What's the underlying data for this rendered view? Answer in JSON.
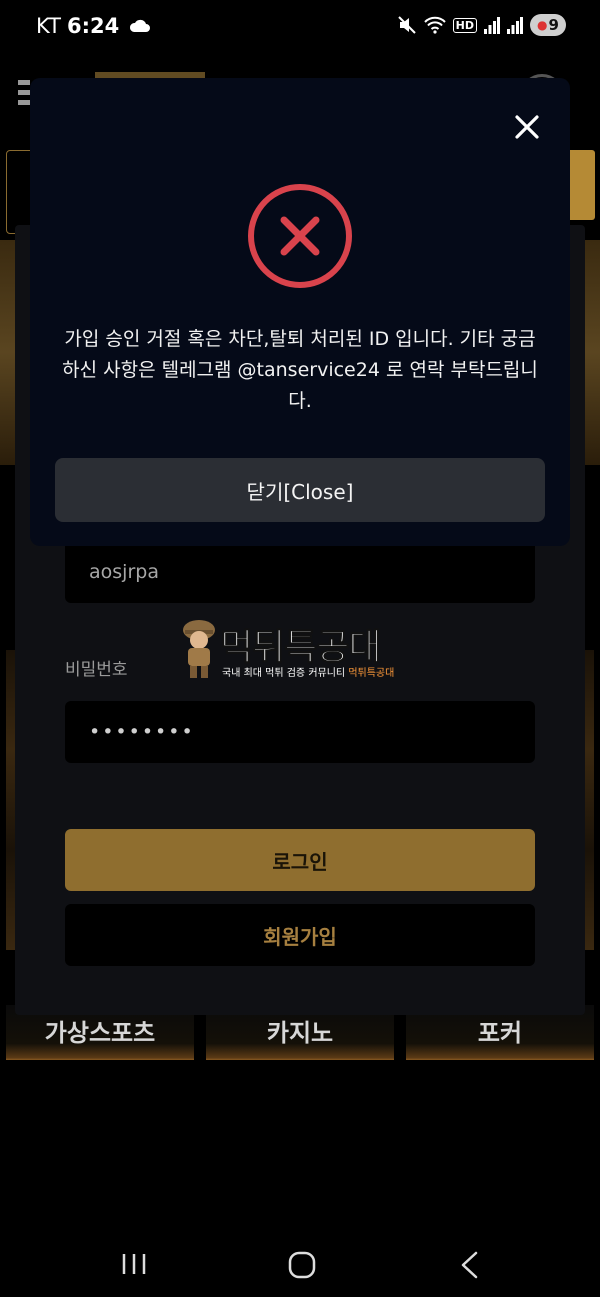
{
  "status_bar": {
    "carrier": "KT",
    "time": "6:24",
    "hd_badge": "HD",
    "battery_level": "9",
    "icons": [
      "cloud-icon",
      "mute-icon",
      "wifi-icon",
      "signal-icon",
      "signal-r-icon",
      "battery-icon"
    ]
  },
  "modal": {
    "message": "가입 승인 거절 혹은 차단,탈퇴 처리된 ID 입니다. 기타 궁금하신 사항은 텔레그램 @tanservice24 로 연락 부탁드립니다.",
    "close_button_label": "닫기[Close]",
    "error_color": "#d9434c"
  },
  "login_form": {
    "username_value": "aosjrpa",
    "password_label": "비밀번호",
    "password_value": "••••••••",
    "login_button": "로그인",
    "signup_button": "회원가입",
    "accent_color": "#8f6e2f"
  },
  "categories": [
    "가상스포츠",
    "카지노",
    "포커"
  ],
  "watermark": {
    "title": "먹튀특공대",
    "subtitle_prefix": "국내 최대 먹튀 검증 커뮤니티",
    "subtitle_highlight": "먹튀특공대"
  },
  "nav_bar": {
    "icons": [
      "recent-apps-icon",
      "home-icon",
      "back-icon"
    ]
  }
}
